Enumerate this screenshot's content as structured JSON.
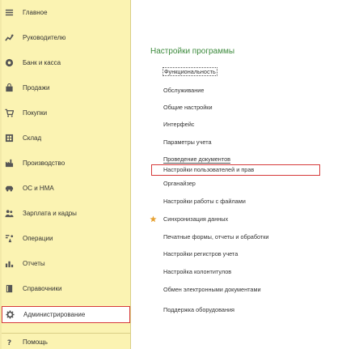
{
  "sidebar": {
    "items": [
      {
        "label": "Главное",
        "icon": "menu-lines-icon"
      },
      {
        "label": "Руководителю",
        "icon": "trend-chart-icon"
      },
      {
        "label": "Банк и касса",
        "icon": "coin-icon"
      },
      {
        "label": "Продажи",
        "icon": "shopping-bag-icon"
      },
      {
        "label": "Покупки",
        "icon": "cart-icon"
      },
      {
        "label": "Склад",
        "icon": "warehouse-icon"
      },
      {
        "label": "Производство",
        "icon": "factory-icon"
      },
      {
        "label": "ОС и НМА",
        "icon": "car-icon"
      },
      {
        "label": "Зарплата и кадры",
        "icon": "people-icon"
      },
      {
        "label": "Операции",
        "icon": "operations-icon"
      },
      {
        "label": "Отчеты",
        "icon": "bar-chart-icon"
      },
      {
        "label": "Справочники",
        "icon": "book-icon"
      },
      {
        "label": "Администрирование",
        "icon": "gear-icon"
      },
      {
        "label": "Помощь",
        "icon": "question-icon"
      }
    ],
    "active_index": 12
  },
  "main": {
    "section_title": "Настройки программы",
    "links": [
      {
        "label": "Функциональность"
      },
      {
        "label": "Обслуживание"
      },
      {
        "label": "Общие настройки"
      },
      {
        "label": "Интерфейс"
      },
      {
        "label": "Параметры учета"
      },
      {
        "label": "Проведение документов"
      },
      {
        "label": "Настройки пользователей и прав"
      },
      {
        "label": "Органайзер"
      },
      {
        "label": "Настройки работы с файлами"
      },
      {
        "label": "Синхронизация данных"
      },
      {
        "label": "Печатные формы, отчеты и обработки"
      },
      {
        "label": "Настройки регистров учета"
      },
      {
        "label": "Настройка колонтитулов"
      },
      {
        "label": "Обмен электронными документами"
      },
      {
        "label": "Поддержка оборудования"
      }
    ]
  },
  "colors": {
    "sidebar_bg": "#fbf3b2",
    "title_green": "#3c8a3c",
    "highlight_red": "#d63a3a",
    "star_orange": "#e6a030"
  }
}
